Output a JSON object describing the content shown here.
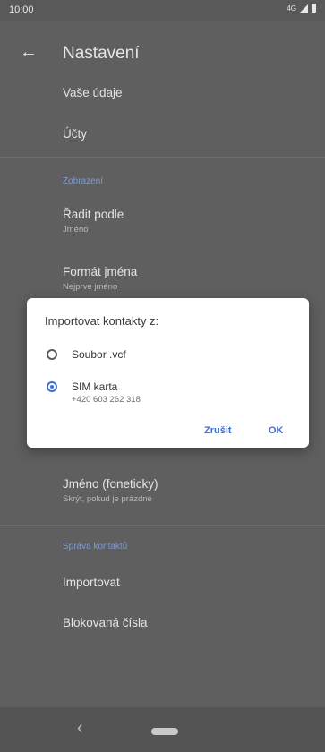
{
  "status_bar": {
    "time": "10:00",
    "network": "4G"
  },
  "header": {
    "title": "Nastavení"
  },
  "settings": {
    "item_your_info": "Vaše údaje",
    "item_accounts": "Účty",
    "section_display": "Zobrazení",
    "sort_by": {
      "label": "Řadit podle",
      "value": "Jméno"
    },
    "name_format": {
      "label": "Formát jména",
      "value": "Nejprve jméno"
    },
    "phonetic_name": {
      "label": "Jméno (foneticky)",
      "value": "Skrýt, pokud je prázdné"
    },
    "section_manage": "Správa kontaktů",
    "item_import": "Importovat",
    "item_blocked": "Blokovaná čísla"
  },
  "dialog": {
    "title": "Importovat kontakty z:",
    "options": [
      {
        "label": "Soubor .vcf",
        "selected": false
      },
      {
        "label": "SIM karta",
        "sub": "+420 603 262 318",
        "selected": true
      }
    ],
    "cancel_label": "Zrušit",
    "ok_label": "OK"
  },
  "colors": {
    "accent": "#3f6fd4",
    "scrim": "#5f5f5f"
  }
}
